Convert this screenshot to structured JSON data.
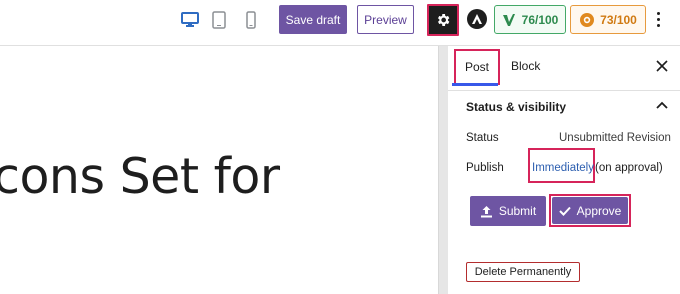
{
  "toolbar": {
    "devices": [
      "desktop-icon",
      "tablet-icon",
      "mobile-icon"
    ],
    "save_draft_label": "Save draft",
    "preview_label": "Preview",
    "score_seo": "76/100",
    "score_readability": "73/100"
  },
  "editor": {
    "heading_text": "cons Set for"
  },
  "sidebar": {
    "tabs": [
      {
        "label": "Post",
        "active": true
      },
      {
        "label": "Block",
        "active": false
      }
    ],
    "panel_title": "Status & visibility",
    "status_label": "Status",
    "status_value": "Unsubmitted Revision",
    "publish_label": "Publish",
    "publish_value": "Immediately",
    "publish_suffix": "(on approval)",
    "submit_label": "Submit",
    "approve_label": "Approve",
    "delete_label": "Delete Permanently"
  },
  "colors": {
    "primary": "#6e55a3",
    "highlight": "#d6245a",
    "link": "#2d5fb0",
    "seo_green": "#43a867",
    "readability_orange": "#e79a3d"
  }
}
